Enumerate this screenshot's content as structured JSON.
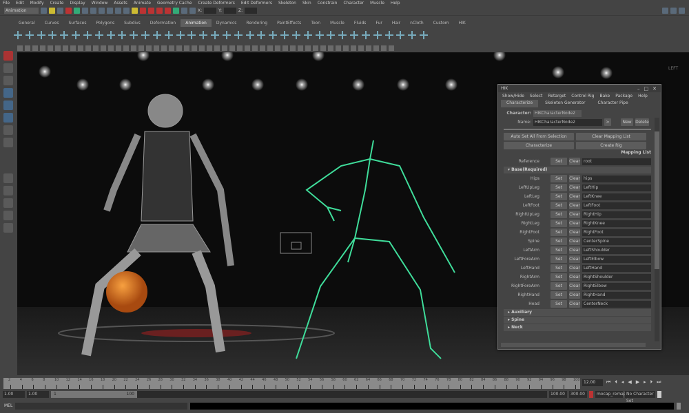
{
  "menubar": [
    "File",
    "Edit",
    "Modify",
    "Create",
    "Display",
    "Window",
    "Assets",
    "Animate",
    "Geometry Cache",
    "Create Deformers",
    "Edit Deformers",
    "Skeleton",
    "Skin",
    "Constrain",
    "Character",
    "Muscle",
    "Help"
  ],
  "statusline": {
    "mode": "Animation",
    "x_label": "X:",
    "y_label": "Y:",
    "z_label": "Z:"
  },
  "shelf_tabs": [
    "General",
    "Curves",
    "Surfaces",
    "Polygons",
    "Subdivs",
    "Deformation",
    "Animation",
    "Dynamics",
    "Rendering",
    "PaintEffects",
    "Toon",
    "Muscle",
    "Fluids",
    "Fur",
    "Hair",
    "nCloth",
    "Custom",
    "HIK"
  ],
  "active_shelf_tab": "Animation",
  "viewport": {
    "cube_label": "LEFT"
  },
  "hik": {
    "title": "HIK",
    "menus": [
      "Show/Hide",
      "Select",
      "Retarget",
      "Control Rig",
      "Bake",
      "Package",
      "Help"
    ],
    "tabs": [
      "Characterize",
      "Skeleton Generator",
      "Character Pipe"
    ],
    "character_label": "Character:",
    "character_value": "HIKCharacterNode2",
    "name_label": "Name:",
    "name_value": "HIKCharacterNode2",
    "arrow": ">",
    "new": "New",
    "delete": "Delete",
    "auto_set": "Auto Set All From Selection",
    "clear_mapping": "Clear Mapping List",
    "characterize": "Characterize",
    "create_rig": "Create Rig",
    "mapping_list": "Mapping List",
    "reference": {
      "label": "Reference",
      "value": "root"
    },
    "set": "Set",
    "clear": "Clear",
    "base_section": "Base(Required)",
    "rows": [
      {
        "label": "Hips",
        "value": "hips"
      },
      {
        "label": "LeftUpLeg",
        "value": "LeftHip"
      },
      {
        "label": "LeftLeg",
        "value": "LeftKnee"
      },
      {
        "label": "LeftFoot",
        "value": "LeftFoot"
      },
      {
        "label": "RightUpLeg",
        "value": "RightHip"
      },
      {
        "label": "RightLeg",
        "value": "RightKnee"
      },
      {
        "label": "RightFoot",
        "value": "RightFoot"
      },
      {
        "label": "Spine",
        "value": "CenterSpine"
      },
      {
        "label": "LeftArm",
        "value": "LeftShoulder"
      },
      {
        "label": "LeftForeArm",
        "value": "LeftElbow"
      },
      {
        "label": "LeftHand",
        "value": "LeftHand"
      },
      {
        "label": "RightArm",
        "value": "RightShoulder"
      },
      {
        "label": "RightForeArm",
        "value": "RightElbow"
      },
      {
        "label": "RightHand",
        "value": "RightHand"
      },
      {
        "label": "Head",
        "value": "CenterNeck"
      }
    ],
    "collapsed_sections": [
      "Auxiliary",
      "Spine",
      "Neck"
    ]
  },
  "timeline": {
    "tick_start": 2,
    "tick_step": 2,
    "tick_end": 100,
    "current_frame": "12.00"
  },
  "range": {
    "start": "1.00",
    "anim_start": "1.00",
    "slider_start": "1",
    "slider_end": "100",
    "end": "100.00",
    "anim_end": "300.00",
    "anim_layer": "mocap_remap",
    "char_set": "No Character Set"
  },
  "mel": {
    "label": "MEL"
  }
}
